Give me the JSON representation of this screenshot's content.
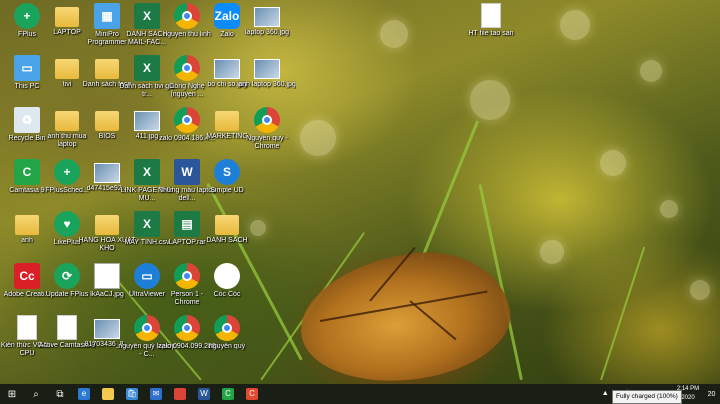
{
  "desktop": {
    "icons": [
      {
        "label": "FPlus",
        "icon": "greenplus-icon",
        "glyph": "+"
      },
      {
        "label": "LAPTOP",
        "icon": "folder-icon",
        "glyph": ""
      },
      {
        "label": "MiniPro Programmer",
        "icon": "programmer-icon",
        "glyph": "▦"
      },
      {
        "label": "DANH SÁCH MAIL-FAC...",
        "icon": "excel-icon",
        "glyph": "X"
      },
      {
        "label": "nguyen thu linh",
        "icon": "chrome-icon",
        "glyph": ""
      },
      {
        "label": "Zalo",
        "icon": "zalo-icon",
        "glyph": "Zalo"
      },
      {
        "label": "laptop 360.jpg",
        "icon": "image-icon",
        "glyph": ""
      },
      {
        "label": "HT file tao san",
        "icon": "document-icon",
        "glyph": ""
      },
      {
        "label": "This PC",
        "icon": "pc-icon",
        "glyph": "▭"
      },
      {
        "label": "tivi",
        "icon": "folder-icon",
        "glyph": ""
      },
      {
        "label": "Danh sách face",
        "icon": "folder-icon",
        "glyph": ""
      },
      {
        "label": "Danh sách tivi giá tr...",
        "icon": "excel-icon",
        "glyph": "X"
      },
      {
        "label": "Công Nghệ (nguyen ...",
        "icon": "chrome-icon",
        "glyph": ""
      },
      {
        "label": "bo chi so.jpg",
        "icon": "image-icon",
        "glyph": ""
      },
      {
        "label": "anh laptop 360.jpg",
        "icon": "image-icon",
        "glyph": ""
      },
      {
        "label": "Recycle Bin",
        "icon": "recycle-bin-icon",
        "glyph": "♻"
      },
      {
        "label": "ảnh thu mua laptop",
        "icon": "folder-icon",
        "glyph": ""
      },
      {
        "label": "BIOS",
        "icon": "folder-icon",
        "glyph": ""
      },
      {
        "label": "411.jpg",
        "icon": "image-icon",
        "glyph": ""
      },
      {
        "label": "zalo 0904.186.4...",
        "icon": "chrome-icon",
        "glyph": ""
      },
      {
        "label": "MARKETING",
        "icon": "folder-icon",
        "glyph": ""
      },
      {
        "label": "Nguyễn quý - Chrome",
        "icon": "chrome-icon",
        "glyph": ""
      },
      {
        "label": "Camtasia 9",
        "icon": "camtasia-icon",
        "glyph": "C"
      },
      {
        "label": "FPlusSched...",
        "icon": "greenplus-icon",
        "glyph": "+"
      },
      {
        "label": "d47415e92...",
        "icon": "image-icon",
        "glyph": ""
      },
      {
        "label": "LINK PAGE THU MU...",
        "icon": "excel-icon",
        "glyph": "X"
      },
      {
        "label": "Những mẫu laptop dell...",
        "icon": "word-icon",
        "glyph": "W"
      },
      {
        "label": "Simple UD",
        "icon": "blueapp-icon",
        "glyph": "S"
      },
      {
        "label": "anh",
        "icon": "folder-icon",
        "glyph": ""
      },
      {
        "label": "LikePlus",
        "icon": "likeplus-icon",
        "glyph": "♥"
      },
      {
        "label": "HANG HOA XUAT KHO",
        "icon": "folder-icon",
        "glyph": ""
      },
      {
        "label": "MAY TINH.csv",
        "icon": "excel-icon",
        "glyph": "X"
      },
      {
        "label": "LAPTOP.rar",
        "icon": "archive-icon",
        "glyph": "▤"
      },
      {
        "label": "DANH SACH",
        "icon": "folder-icon",
        "glyph": ""
      },
      {
        "label": "Adobe Creati...",
        "icon": "adobe-icon",
        "glyph": "Cc"
      },
      {
        "label": "Update FPlus",
        "icon": "greenplus-icon",
        "glyph": "⟳"
      },
      {
        "label": "lkAaCJ.jpg",
        "icon": "text-file-icon",
        "glyph": "≡"
      },
      {
        "label": "UltraViewer",
        "icon": "monitor-icon",
        "glyph": "▭"
      },
      {
        "label": "Person 1 - Chrome",
        "icon": "chrome-icon",
        "glyph": ""
      },
      {
        "label": "Cốc Cốc",
        "icon": "coccoc-icon",
        "glyph": "◐"
      },
      {
        "label": "Kiến thức VGA + CPU",
        "icon": "document-icon",
        "glyph": ""
      },
      {
        "label": "Active Camtasia 9",
        "icon": "document-icon",
        "glyph": ""
      },
      {
        "label": "81703436_8...",
        "icon": "image-icon",
        "glyph": ""
      },
      {
        "label": "nguyễn quý laptop - C...",
        "icon": "chrome-icon",
        "glyph": ""
      },
      {
        "label": "zalo 0904.099.288",
        "icon": "chrome-icon",
        "glyph": ""
      },
      {
        "label": "nguyễn quý",
        "icon": "chrome-icon",
        "glyph": ""
      }
    ]
  },
  "taskbar": {
    "start": "⊞",
    "search": "⌕",
    "task_view": "⧉",
    "apps": [
      {
        "name": "edge",
        "color": "#2d7ad6",
        "glyph": "e"
      },
      {
        "name": "file-explorer",
        "color": "#f2c94c",
        "glyph": ""
      },
      {
        "name": "store",
        "color": "#3a8ad6",
        "glyph": "🛍"
      },
      {
        "name": "mail",
        "color": "#2f6fcf",
        "glyph": "✉"
      },
      {
        "name": "chrome",
        "color": "#db4437",
        "glyph": ""
      },
      {
        "name": "word",
        "color": "#2b579a",
        "glyph": "W"
      },
      {
        "name": "camtasia",
        "color": "#22a447",
        "glyph": "C"
      },
      {
        "name": "camtasia-recorder",
        "color": "#e2492f",
        "glyph": "C"
      }
    ],
    "tray_icons": [
      "▲",
      "▭",
      "🔋"
    ],
    "tooltip": "Fully charged (100%)",
    "clock_time": "2:14 PM",
    "clock_date": "2020",
    "notification": "20"
  }
}
